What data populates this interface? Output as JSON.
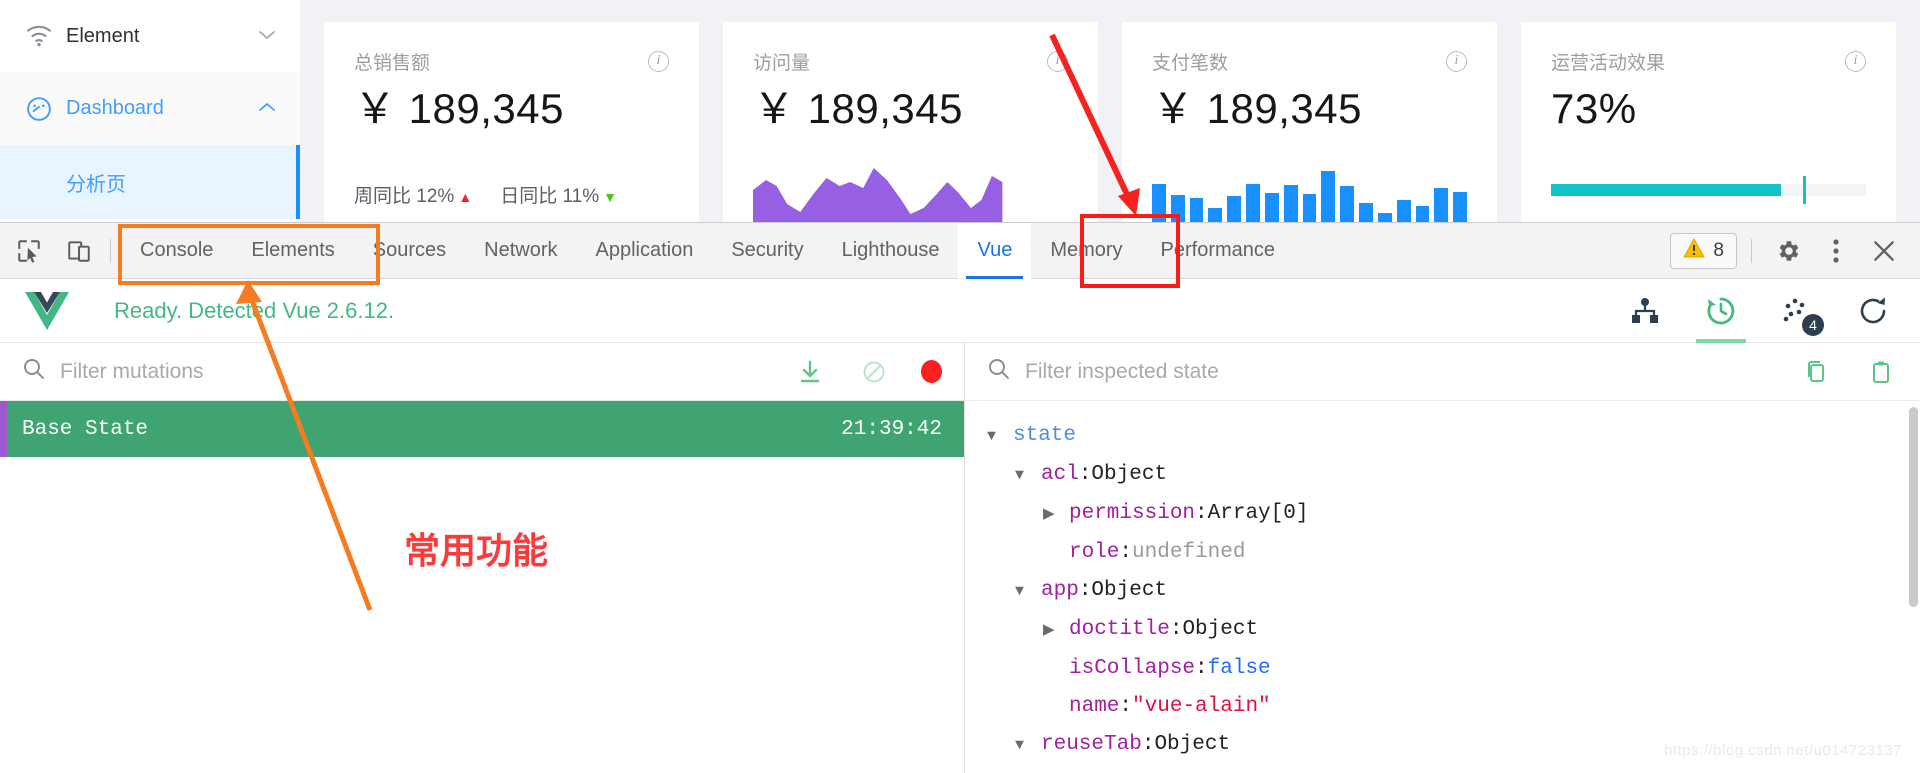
{
  "app": {
    "sidebar": {
      "items": [
        {
          "label": "Element",
          "icon": "wifi-icon",
          "arrow": "chevron-down-icon",
          "state": "collapsed"
        },
        {
          "label": "Dashboard",
          "icon": "dashboard-gauge-icon",
          "arrow": "chevron-up-icon",
          "state": "expanded"
        }
      ],
      "sub_item": {
        "label": "分析页",
        "active": true
      }
    },
    "cards": [
      {
        "title": "总销售额",
        "value": "￥ 189,345",
        "info_icon": "info-circle-icon",
        "footer": [
          {
            "label": "周同比",
            "value": "12%",
            "trend": "up",
            "trend_color": "#f5222d"
          },
          {
            "label": "日同比",
            "value": "11%",
            "trend": "down",
            "trend_color": "#52c41a"
          }
        ],
        "visual": "none"
      },
      {
        "title": "访问量",
        "value": "￥ 189,345",
        "info_icon": "info-circle-icon",
        "footer": [],
        "visual": "area-chart",
        "visual_color": "#975fe4"
      },
      {
        "title": "支付笔数",
        "value": "￥ 189,345",
        "info_icon": "info-circle-icon",
        "footer": [],
        "visual": "bar-chart",
        "visual_color": "#1890ff"
      },
      {
        "title": "运营活动效果",
        "value": "73%",
        "info_icon": "info-circle-icon",
        "footer": [],
        "visual": "progress-bar",
        "visual_color": "#13c2c2",
        "progress_percent": 73
      }
    ]
  },
  "devtools": {
    "left_tools": [
      {
        "name": "inspect-element-icon",
        "title": "Inspect"
      },
      {
        "name": "device-toolbar-icon",
        "title": "Toggle device toolbar"
      }
    ],
    "tabs": [
      {
        "label": "Console",
        "active": false
      },
      {
        "label": "Elements",
        "active": false
      },
      {
        "label": "Sources",
        "active": false
      },
      {
        "label": "Network",
        "active": false
      },
      {
        "label": "Application",
        "active": false
      },
      {
        "label": "Security",
        "active": false
      },
      {
        "label": "Lighthouse",
        "active": false
      },
      {
        "label": "Vue",
        "active": true
      },
      {
        "label": "Memory",
        "active": false
      },
      {
        "label": "Performance",
        "active": false
      }
    ],
    "warnings": {
      "icon": "warning-triangle-icon",
      "count": "8"
    },
    "right_icons": [
      {
        "name": "gear-icon"
      },
      {
        "name": "kebab-menu-icon"
      },
      {
        "name": "close-icon"
      }
    ]
  },
  "vue_panel": {
    "logo": "vue-logo-icon",
    "status_text": "Ready. Detected Vue 2.6.12.",
    "toolbar": [
      {
        "name": "component-tree-icon",
        "active": false,
        "badge": ""
      },
      {
        "name": "vuex-history-icon",
        "active": true,
        "badge": ""
      },
      {
        "name": "events-icon",
        "active": false,
        "badge": "4"
      },
      {
        "name": "refresh-icon",
        "active": false,
        "badge": ""
      }
    ],
    "left": {
      "search_icon": "search-icon",
      "filter_placeholder": "Filter mutations",
      "filter_value": "",
      "actions": [
        {
          "name": "export-icon"
        },
        {
          "name": "clear-disabled-icon"
        },
        {
          "name": "record-icon"
        }
      ],
      "mutations": [
        {
          "label": "Base State",
          "time": "21:39:42",
          "selected": true
        }
      ]
    },
    "right": {
      "search_icon": "search-icon",
      "filter_placeholder": "Filter inspected state",
      "filter_value": "",
      "actions": [
        {
          "name": "copy-icon"
        },
        {
          "name": "paste-clipboard-icon"
        }
      ],
      "state_tree": [
        {
          "depth": 0,
          "caret": "open",
          "key": "state",
          "key_kind": "root",
          "sep": "",
          "value": "",
          "value_kind": ""
        },
        {
          "depth": 1,
          "caret": "open",
          "key": "acl",
          "key_kind": "key",
          "sep": ":",
          "value": "Object",
          "value_kind": "type"
        },
        {
          "depth": 2,
          "caret": "closed",
          "key": "permission",
          "key_kind": "key",
          "sep": ":",
          "value": "Array[0]",
          "value_kind": "type"
        },
        {
          "depth": 2,
          "caret": "none",
          "key": "role",
          "key_kind": "key",
          "sep": ":",
          "value": "undefined",
          "value_kind": "undef"
        },
        {
          "depth": 1,
          "caret": "open",
          "key": "app",
          "key_kind": "key",
          "sep": ":",
          "value": "Object",
          "value_kind": "type"
        },
        {
          "depth": 2,
          "caret": "closed",
          "key": "doctitle",
          "key_kind": "key",
          "sep": ":",
          "value": "Object",
          "value_kind": "type"
        },
        {
          "depth": 2,
          "caret": "none",
          "key": "isCollapse",
          "key_kind": "key",
          "sep": ":",
          "value": "false",
          "value_kind": "bool"
        },
        {
          "depth": 2,
          "caret": "none",
          "key": "name",
          "key_kind": "key",
          "sep": ":",
          "value": "\"vue-alain\"",
          "value_kind": "str"
        },
        {
          "depth": 1,
          "caret": "open",
          "key": "reuseTab",
          "key_kind": "key",
          "sep": ":",
          "value": "Object",
          "value_kind": "type"
        }
      ]
    }
  },
  "annotations": {
    "text_label": "常用功能",
    "text_color": "#fb3b3b",
    "orange_box_color": "#f57c20",
    "red_box_color": "#ff1a1a"
  },
  "watermark": "https://blog.csdn.net/u014723137"
}
